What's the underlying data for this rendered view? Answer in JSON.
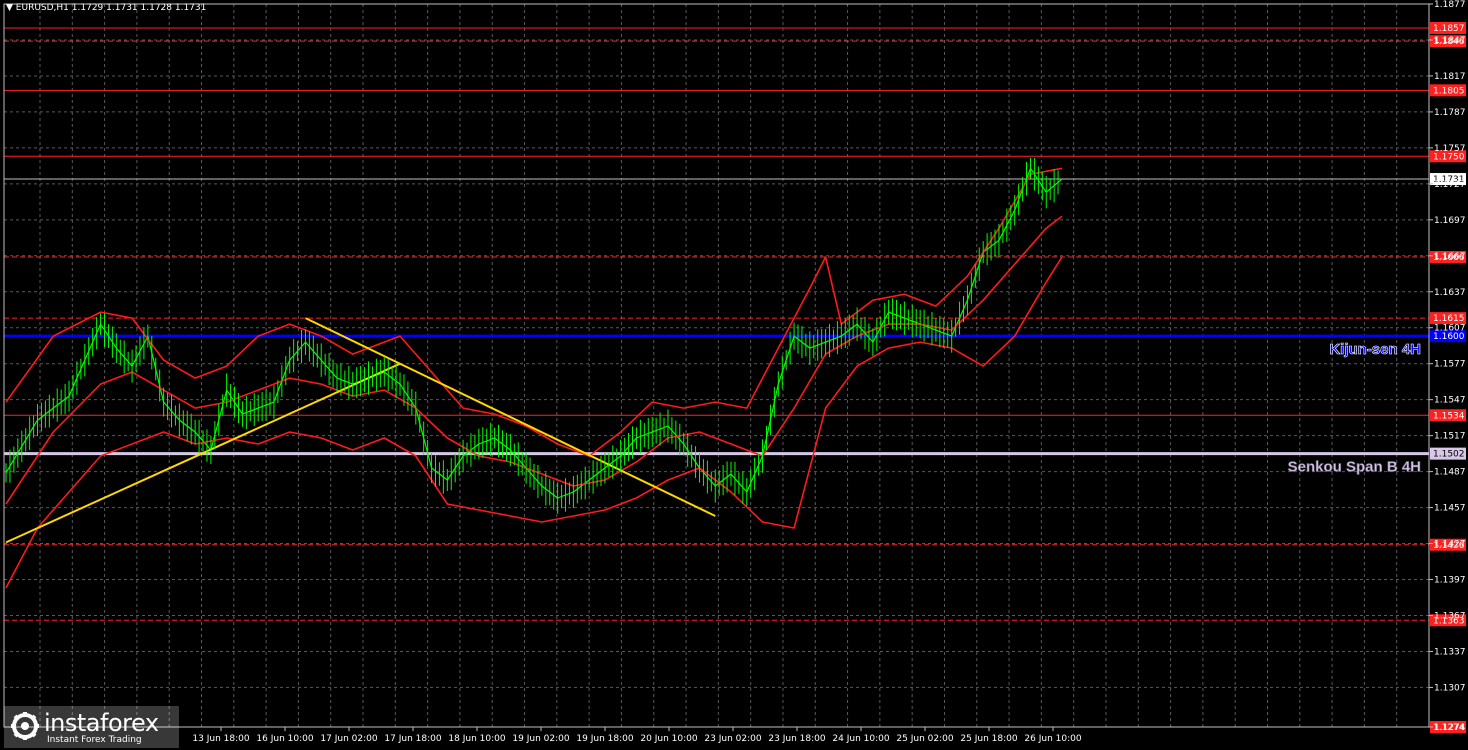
{
  "header": {
    "symbol": "EURUSD,H1",
    "ohlc": "1.1729 1.1731 1.1728 1.1731",
    "menu_icon": "triangle-down-icon"
  },
  "watermark": {
    "brand": "instaforex",
    "tagline": "Instant Forex Trading",
    "icon": "instaforex-logo-icon"
  },
  "chart_data": {
    "type": "line",
    "title": "EURUSD,H1",
    "y_axis": {
      "range": [
        1.1274,
        1.1877
      ],
      "ticks": [
        "1.1877",
        "1.1847",
        "1.1817",
        "1.1787",
        "1.1757",
        "1.1727",
        "1.1697",
        "1.1667",
        "1.1637",
        "1.1607",
        "1.1577",
        "1.1547",
        "1.1517",
        "1.1487",
        "1.1457",
        "1.1427",
        "1.1397",
        "1.1367",
        "1.1337",
        "1.1307",
        "1.1274"
      ]
    },
    "x_axis": {
      "labels": [
        "13 Jun 18:00",
        "16 Jun 10:00",
        "17 Jun 02:00",
        "17 Jun 18:00",
        "18 Jun 10:00",
        "19 Jun 02:00",
        "19 Jun 18:00",
        "20 Jun 10:00",
        "23 Jun 02:00",
        "23 Jun 18:00",
        "24 Jun 10:00",
        "25 Jun 02:00",
        "25 Jun 18:00",
        "26 Jun 10:00"
      ]
    },
    "current_price": "1.1731",
    "levels": [
      {
        "value": 1.1857,
        "label": "1.1857",
        "color": "#ff2020",
        "style": "solid"
      },
      {
        "value": 1.1846,
        "label": "1.1846",
        "color": "#ff2020",
        "style": "dashed"
      },
      {
        "value": 1.1805,
        "label": "1.1805",
        "color": "#ff2020",
        "style": "solid"
      },
      {
        "value": 1.175,
        "label": "1.1750",
        "color": "#ff2020",
        "style": "solid"
      },
      {
        "value": 1.1666,
        "label": "1.1666",
        "color": "#ff2020",
        "style": "dashed"
      },
      {
        "value": 1.1615,
        "label": "1.1615",
        "color": "#ff2020",
        "style": "dashed"
      },
      {
        "value": 1.16,
        "label": "1.1600",
        "color": "#0000ff",
        "style": "solid",
        "name": "Kijun-sen 4H"
      },
      {
        "value": 1.1534,
        "label": "1.1534",
        "color": "#ff2020",
        "style": "solid"
      },
      {
        "value": 1.1502,
        "label": "1.1502",
        "color": "#d8c8e8",
        "style": "solid",
        "name": "Senkou Span B 4H"
      },
      {
        "value": 1.1426,
        "label": "1.1426",
        "color": "#ff2020",
        "style": "dashed"
      },
      {
        "value": 1.1363,
        "label": "1.1363",
        "color": "#ff2020",
        "style": "dashed"
      },
      {
        "value": 1.1274,
        "label": "1.1274",
        "color": "#ff2020",
        "style": "dashed"
      }
    ],
    "series": [
      {
        "name": "price",
        "color": "#00ff00",
        "points": [
          [
            0,
            1.1486
          ],
          [
            2,
            1.153
          ],
          [
            4,
            1.155
          ],
          [
            6,
            1.161
          ],
          [
            7,
            1.159
          ],
          [
            8,
            1.1575
          ],
          [
            9,
            1.16
          ],
          [
            10,
            1.1545
          ],
          [
            11,
            1.153
          ],
          [
            12,
            1.152
          ],
          [
            13,
            1.1505
          ],
          [
            14,
            1.1555
          ],
          [
            15,
            1.1535
          ],
          [
            16,
            1.154
          ],
          [
            17,
            1.1545
          ],
          [
            18,
            1.158
          ],
          [
            19,
            1.1595
          ],
          [
            20,
            1.158
          ],
          [
            21,
            1.1565
          ],
          [
            22,
            1.156
          ],
          [
            24,
            1.157
          ],
          [
            25,
            1.156
          ],
          [
            26,
            1.154
          ],
          [
            27,
            1.149
          ],
          [
            28,
            1.148
          ],
          [
            29,
            1.15
          ],
          [
            30,
            1.151
          ],
          [
            31,
            1.1515
          ],
          [
            32,
            1.1505
          ],
          [
            33,
            1.149
          ],
          [
            34,
            1.1475
          ],
          [
            35,
            1.1465
          ],
          [
            36,
            1.147
          ],
          [
            37,
            1.148
          ],
          [
            38,
            1.149
          ],
          [
            39,
            1.15
          ],
          [
            40,
            1.1515
          ],
          [
            41,
            1.152
          ],
          [
            42,
            1.1525
          ],
          [
            43,
            1.151
          ],
          [
            44,
            1.149
          ],
          [
            45,
            1.1475
          ],
          [
            46,
            1.1485
          ],
          [
            47,
            1.147
          ],
          [
            48,
            1.15
          ],
          [
            49,
            1.156
          ],
          [
            50,
            1.16
          ],
          [
            51,
            1.159
          ],
          [
            52,
            1.1595
          ],
          [
            53,
            1.16
          ],
          [
            54,
            1.161
          ],
          [
            55,
            1.1595
          ],
          [
            56,
            1.162
          ],
          [
            57,
            1.1615
          ],
          [
            58,
            1.161
          ],
          [
            59,
            1.1605
          ],
          [
            60,
            1.16
          ],
          [
            61,
            1.163
          ],
          [
            62,
            1.167
          ],
          [
            63,
            1.168
          ],
          [
            64,
            1.1705
          ],
          [
            65,
            1.174
          ],
          [
            66,
            1.172
          ],
          [
            67,
            1.1731
          ]
        ]
      },
      {
        "name": "bollinger-upper",
        "color": "#ff1a1a",
        "points": [
          [
            0,
            1.1545
          ],
          [
            3,
            1.16
          ],
          [
            6,
            1.162
          ],
          [
            8,
            1.1615
          ],
          [
            10,
            1.158
          ],
          [
            12,
            1.1565
          ],
          [
            14,
            1.1575
          ],
          [
            16,
            1.16
          ],
          [
            18,
            1.161
          ],
          [
            20,
            1.16
          ],
          [
            22,
            1.1585
          ],
          [
            24,
            1.1595
          ],
          [
            25,
            1.16
          ],
          [
            27,
            1.157
          ],
          [
            29,
            1.154
          ],
          [
            31,
            1.1535
          ],
          [
            33,
            1.1525
          ],
          [
            35,
            1.151
          ],
          [
            37,
            1.15
          ],
          [
            39,
            1.152
          ],
          [
            41,
            1.1545
          ],
          [
            43,
            1.154
          ],
          [
            45,
            1.1545
          ],
          [
            47,
            1.154
          ],
          [
            49,
            1.159
          ],
          [
            51,
            1.164
          ],
          [
            52,
            1.1666
          ],
          [
            53,
            1.161
          ],
          [
            55,
            1.163
          ],
          [
            57,
            1.1635
          ],
          [
            59,
            1.1625
          ],
          [
            61,
            1.165
          ],
          [
            63,
            1.169
          ],
          [
            65,
            1.1735
          ],
          [
            67,
            1.174
          ]
        ]
      },
      {
        "name": "bollinger-middle",
        "color": "#ff1a1a",
        "points": [
          [
            0,
            1.146
          ],
          [
            3,
            1.152
          ],
          [
            6,
            1.156
          ],
          [
            8,
            1.157
          ],
          [
            10,
            1.1555
          ],
          [
            12,
            1.154
          ],
          [
            14,
            1.1545
          ],
          [
            16,
            1.1555
          ],
          [
            18,
            1.1565
          ],
          [
            20,
            1.156
          ],
          [
            22,
            1.155
          ],
          [
            24,
            1.1555
          ],
          [
            26,
            1.154
          ],
          [
            28,
            1.1515
          ],
          [
            30,
            1.15
          ],
          [
            32,
            1.1495
          ],
          [
            34,
            1.1485
          ],
          [
            36,
            1.1475
          ],
          [
            38,
            1.148
          ],
          [
            40,
            1.1495
          ],
          [
            42,
            1.1515
          ],
          [
            44,
            1.152
          ],
          [
            46,
            1.151
          ],
          [
            48,
            1.15
          ],
          [
            50,
            1.154
          ],
          [
            52,
            1.1585
          ],
          [
            54,
            1.16
          ],
          [
            56,
            1.161
          ],
          [
            58,
            1.161
          ],
          [
            60,
            1.1605
          ],
          [
            62,
            1.163
          ],
          [
            64,
            1.166
          ],
          [
            66,
            1.169
          ],
          [
            67,
            1.17
          ]
        ]
      },
      {
        "name": "bollinger-lower",
        "color": "#ff1a1a",
        "points": [
          [
            0,
            1.139
          ],
          [
            2,
            1.144
          ],
          [
            4,
            1.147
          ],
          [
            6,
            1.15
          ],
          [
            8,
            1.151
          ],
          [
            10,
            1.152
          ],
          [
            12,
            1.151
          ],
          [
            14,
            1.1515
          ],
          [
            16,
            1.151
          ],
          [
            18,
            1.152
          ],
          [
            20,
            1.1515
          ],
          [
            22,
            1.1505
          ],
          [
            24,
            1.1515
          ],
          [
            26,
            1.15
          ],
          [
            28,
            1.146
          ],
          [
            30,
            1.1455
          ],
          [
            32,
            1.145
          ],
          [
            34,
            1.1445
          ],
          [
            36,
            1.145
          ],
          [
            38,
            1.1455
          ],
          [
            40,
            1.1465
          ],
          [
            42,
            1.148
          ],
          [
            44,
            1.149
          ],
          [
            46,
            1.147
          ],
          [
            48,
            1.1445
          ],
          [
            50,
            1.144
          ],
          [
            52,
            1.154
          ],
          [
            54,
            1.1575
          ],
          [
            56,
            1.159
          ],
          [
            58,
            1.1595
          ],
          [
            60,
            1.159
          ],
          [
            62,
            1.1575
          ],
          [
            64,
            1.16
          ],
          [
            66,
            1.1645
          ],
          [
            67,
            1.1666
          ]
        ]
      },
      {
        "name": "trendline-up",
        "color": "#ffd700",
        "points": [
          [
            0,
            1.1428
          ],
          [
            25,
            1.1577
          ]
        ]
      },
      {
        "name": "trendline-down",
        "color": "#ffd700",
        "points": [
          [
            19,
            1.1615
          ],
          [
            45,
            1.145
          ]
        ]
      }
    ],
    "grid": true,
    "annotations": [
      "Kijun-sen 4H",
      "Senkou Span B 4H"
    ]
  }
}
